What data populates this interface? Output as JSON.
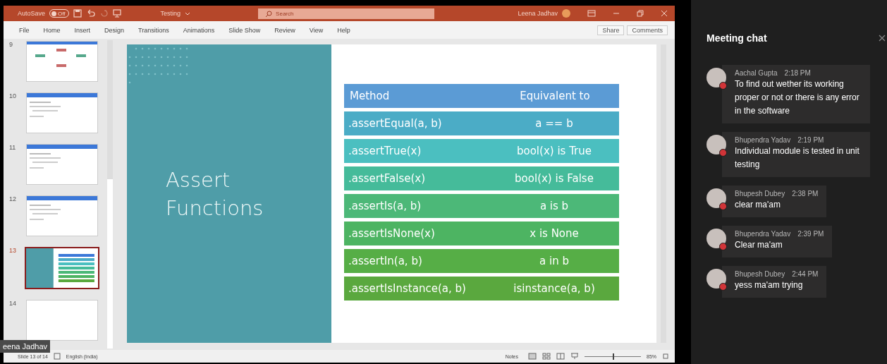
{
  "title_bar": {
    "autosave_label": "AutoSave",
    "autosave_toggle": "Off",
    "autosave_on": false,
    "file_name": "Testing",
    "search": {
      "placeholder": "Search"
    },
    "user": "Leena Jadhav"
  },
  "ribbon_tabs": [
    {
      "label": "File",
      "selected": false
    },
    {
      "label": "Home",
      "selected": false
    },
    {
      "label": "Insert",
      "selected": false
    },
    {
      "label": "Design",
      "selected": false
    },
    {
      "label": "Transitions",
      "selected": false
    },
    {
      "label": "Animations",
      "selected": false
    },
    {
      "label": "Slide Show",
      "selected": false
    },
    {
      "label": "Review",
      "selected": false
    },
    {
      "label": "View",
      "selected": false
    },
    {
      "label": "Help",
      "selected": false
    }
  ],
  "ribbon_actions": [
    "Share",
    "Comments"
  ],
  "thumbnails": [
    {
      "number": "9",
      "kind": "diagram",
      "selected": false
    },
    {
      "number": "10",
      "kind": "text",
      "selected": false
    },
    {
      "number": "11",
      "kind": "text",
      "selected": false
    },
    {
      "number": "12",
      "kind": "text",
      "selected": false
    },
    {
      "number": "13",
      "kind": "table",
      "selected": true
    },
    {
      "number": "14",
      "kind": "blank",
      "selected": false
    }
  ],
  "slide": {
    "title_lines": [
      "Assert",
      "Functions"
    ],
    "table": {
      "columns": [
        "Method",
        "Equivalent to"
      ],
      "rows": [
        {
          "method": ".assertEqual(a, b)",
          "equivalent": "a == b",
          "color": "#4bacc6"
        },
        {
          "method": ".assertTrue(x)",
          "equivalent": "bool(x) is True",
          "color": "#4bbfc0"
        },
        {
          "method": ".assertFalse(x)",
          "equivalent": "bool(x) is False",
          "color": "#45bb9a"
        },
        {
          "method": ".assertIs(a, b)",
          "equivalent": "a is b",
          "color": "#4cb878"
        },
        {
          "method": ".assertIsNone(x)",
          "equivalent": "x is None",
          "color": "#4db462"
        },
        {
          "method": ".assertIn(a, b)",
          "equivalent": "a in b",
          "color": "#56ae46"
        },
        {
          "method": ".assertIsInstance(a, b)",
          "equivalent": "isinstance(a, b)",
          "color": "#5aa83e"
        }
      ]
    }
  },
  "name_tag": "eena Jadhav",
  "status_bar": {
    "slide_position": "Slide 13 of 14",
    "language": "English (India)",
    "notes": "Notes",
    "zoom": "85%",
    "level": 0.5
  },
  "chat": {
    "title": "Meeting chat",
    "messages": [
      {
        "name": "Aachal Gupta",
        "time": "2:18 PM",
        "text": "To find out wether its working proper or not or there is any error in the software"
      },
      {
        "name": "Bhupendra Yadav",
        "time": "2:19 PM",
        "text": "Individual module is tested in unit testing"
      },
      {
        "name": "Bhupesh Dubey",
        "time": "2:38 PM",
        "text": "clear ma'am"
      },
      {
        "name": "Bhupendra Yadav",
        "time": "2:39 PM",
        "text": "Clear ma'am"
      },
      {
        "name": "Bhupesh Dubey",
        "time": "2:44 PM",
        "text": "yess ma'am trying"
      }
    ]
  }
}
